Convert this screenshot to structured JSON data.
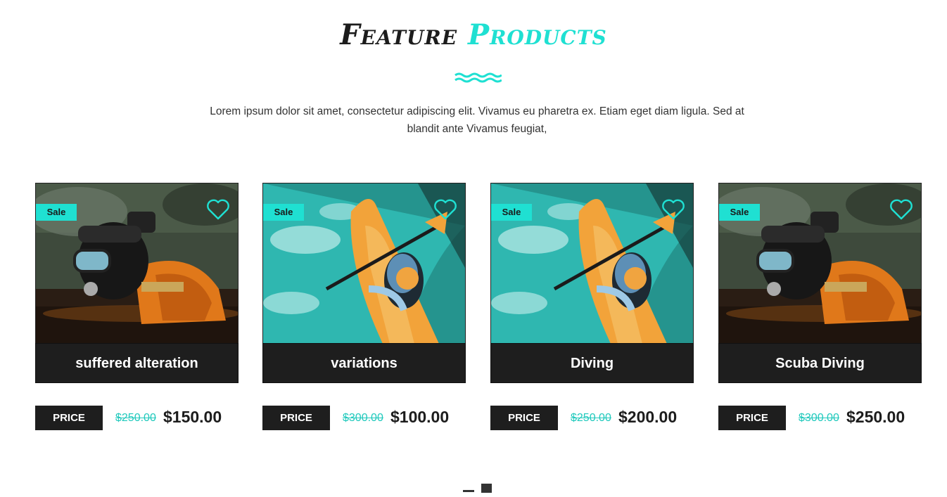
{
  "section": {
    "title_part1": "Feature",
    "title_part2": "Products",
    "description": "Lorem ipsum dolor sit amet, consectetur adipiscing elit. Vivamus eu pharetra ex. Etiam eget diam ligula. Sed at blandit ante Vivamus feugiat,"
  },
  "colors": {
    "accent": "#1fe0d2",
    "dark": "#1e1e1e"
  },
  "products": [
    {
      "title": "suffered alteration",
      "badge": "Sale",
      "price_label": "PRICE",
      "old_price": "$250.00",
      "new_price": "$150.00",
      "image": "scuba-diver-photo",
      "icon": "heart-icon"
    },
    {
      "title": "variations",
      "badge": "Sale",
      "price_label": "PRICE",
      "old_price": "$300.00",
      "new_price": "$100.00",
      "image": "kayaker-photo",
      "icon": "heart-icon"
    },
    {
      "title": "Diving",
      "badge": "Sale",
      "price_label": "PRICE",
      "old_price": "$250.00",
      "new_price": "$200.00",
      "image": "kayaker-photo",
      "icon": "heart-icon"
    },
    {
      "title": "Scuba Diving",
      "badge": "Sale",
      "price_label": "PRICE",
      "old_price": "$300.00",
      "new_price": "$250.00",
      "image": "scuba-diver-photo",
      "icon": "heart-icon"
    }
  ],
  "pager": {
    "pages": 2,
    "active": 2
  }
}
